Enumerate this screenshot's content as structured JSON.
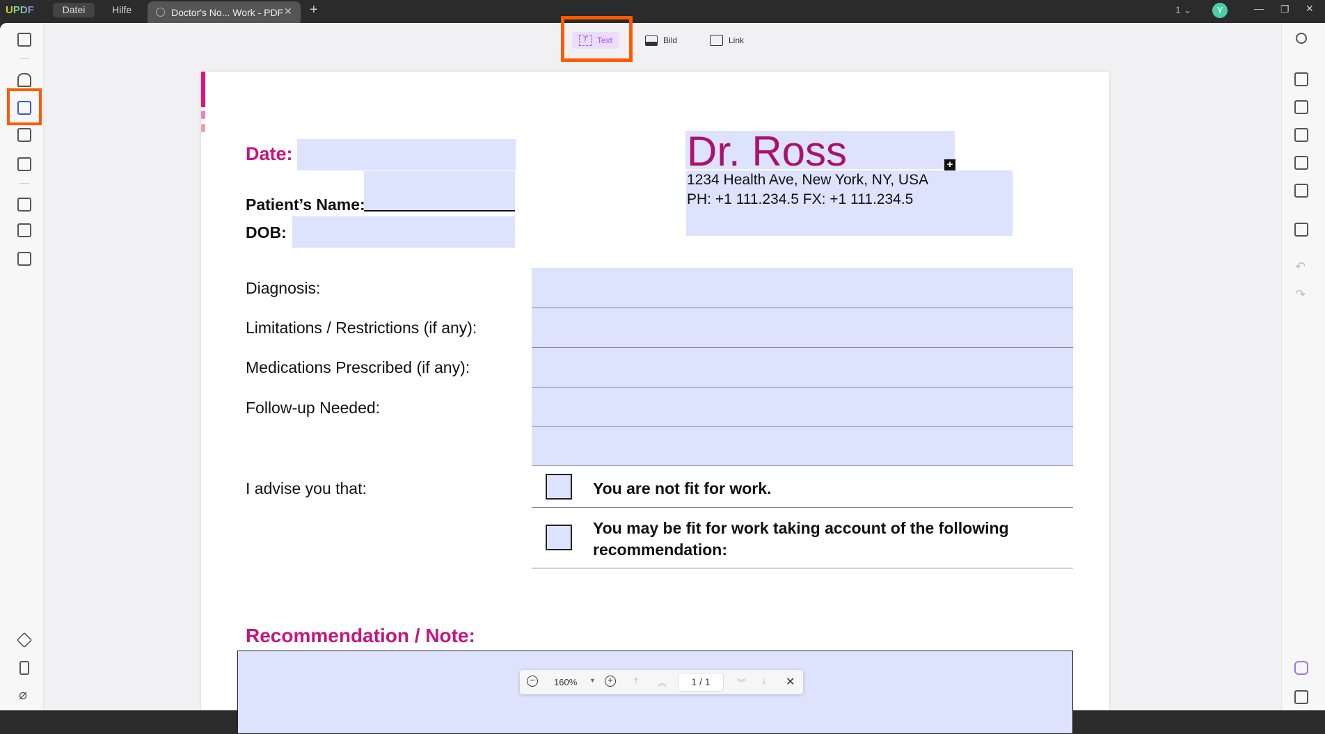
{
  "titlebar": {
    "logo": "UPDF",
    "menu": [
      "Datei",
      "Hilfe"
    ],
    "tab": "Doctor's No... Work - PDF",
    "page_count": "1",
    "avatar": "Y"
  },
  "toolbar": {
    "items": [
      {
        "label": "Text",
        "icon": "text-icon",
        "active": true
      },
      {
        "label": "Bild",
        "icon": "image-icon"
      },
      {
        "label": "Link",
        "icon": "link-icon"
      }
    ]
  },
  "doc": {
    "date_label": "Date:",
    "patient_label": "Patient’s Name:",
    "dob_label": "DOB:",
    "doctor": "Dr. Ross",
    "address": "1234 Health Ave, New York, NY, USA",
    "phone": "PH: +1 111.234.5 FX: +1 111.234.5",
    "rows": [
      "Diagnosis:",
      "Limitations / Restrictions (if any):",
      "Medications Prescribed (if any):",
      "Follow-up Needed:"
    ],
    "advise_label": "I advise you that:",
    "option1": "You are not fit for work.",
    "option2_line1": "You may be fit for work taking account of the following",
    "option2_line2": "recommendation:",
    "rec_label": "Recommendation / Note:"
  },
  "zoombar": {
    "zoom": "160%",
    "page": "1 / 1"
  },
  "colors": {
    "accent": "#c5177e",
    "field": "#dde2fd",
    "highlight": "#ff5a00"
  }
}
